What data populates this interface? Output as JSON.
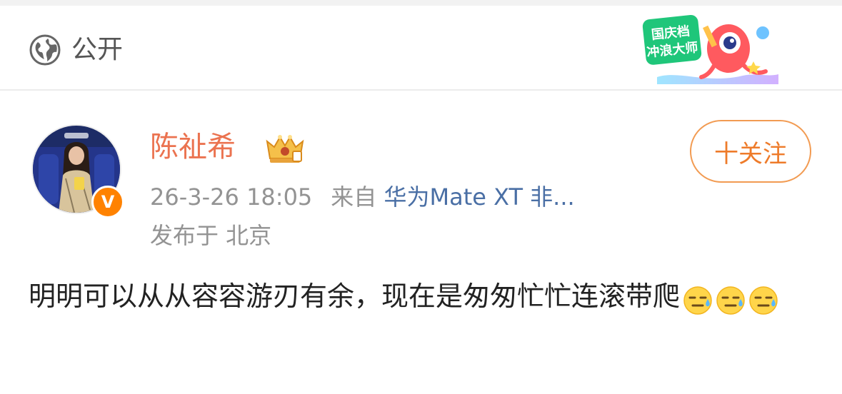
{
  "header": {
    "visibility_icon": "globe-icon",
    "visibility_label": "公开",
    "promo_badge": {
      "text_line1": "国庆档",
      "text_line2": "冲浪大师"
    }
  },
  "post": {
    "author": {
      "name": "陈祉希",
      "verified_badge": "V",
      "crown_icon": "crown-member-icon"
    },
    "follow_label": "十关注",
    "time": "26-3-26 18:05",
    "source_prefix": "来自",
    "source_device": "华为Mate XT 非...",
    "location": "发布于 北京",
    "text": "明明可以从从容容游刃有余，现在是匆匆忙忙连滚带爬",
    "emoji": [
      "sweat-emoji",
      "sweat-emoji",
      "sweat-emoji"
    ]
  },
  "colors": {
    "username": "#eb7350",
    "follow": "#ee7b2a",
    "link": "#4a6fa5",
    "meta": "#939393",
    "badge": "#ff8200"
  }
}
